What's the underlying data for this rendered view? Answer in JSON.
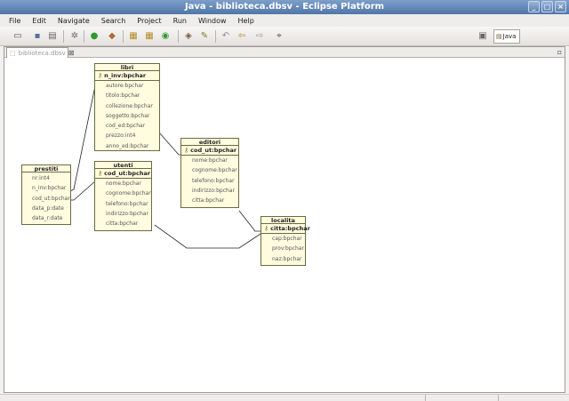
{
  "window": {
    "title": "Java - biblioteca.dbsv - Eclipse Platform",
    "buttons": [
      "_",
      "□",
      "×"
    ]
  },
  "menu": [
    "File",
    "Edit",
    "Navigate",
    "Search",
    "Project",
    "Run",
    "Window",
    "Help"
  ],
  "perspective": {
    "label": "Java"
  },
  "editor": {
    "tab_label": "biblioteca.dbsv"
  },
  "diagram": {
    "libri": {
      "name": "libri",
      "pk": "n_inv:bpchar",
      "fields": [
        "autore:bpchar",
        "titolo:bpchar",
        "collezione:bpchar",
        "soggetto:bpchar",
        "cod_ed:bpchar",
        "prezzo:int4",
        "anno_ed:bpchar"
      ]
    },
    "prestiti": {
      "name": "prestiti",
      "pk": "",
      "fields": [
        "nr:int4",
        "n_inv:bpchar",
        "cod_ut:bpchar",
        "data_p:date",
        "data_r:date"
      ]
    },
    "utenti": {
      "name": "utenti",
      "pk": "cod_ut:bpchar",
      "fields": [
        "nome:bpchar",
        "cognome:bpchar",
        "telefono:bpchar",
        "indirizzo:bpchar",
        "citta:bpchar"
      ]
    },
    "editori": {
      "name": "editori",
      "pk": "cod_ut:bpchar",
      "fields": [
        "nome:bpchar",
        "cognome:bpchar",
        "telefono:bpchar",
        "indirizzo:bpchar",
        "citta:bpchar"
      ]
    },
    "localita": {
      "name": "localita",
      "pk": "citta:bpchar",
      "fields": [
        "cap:bpchar",
        "prov:bpchar",
        "naz:bpchar"
      ]
    }
  }
}
